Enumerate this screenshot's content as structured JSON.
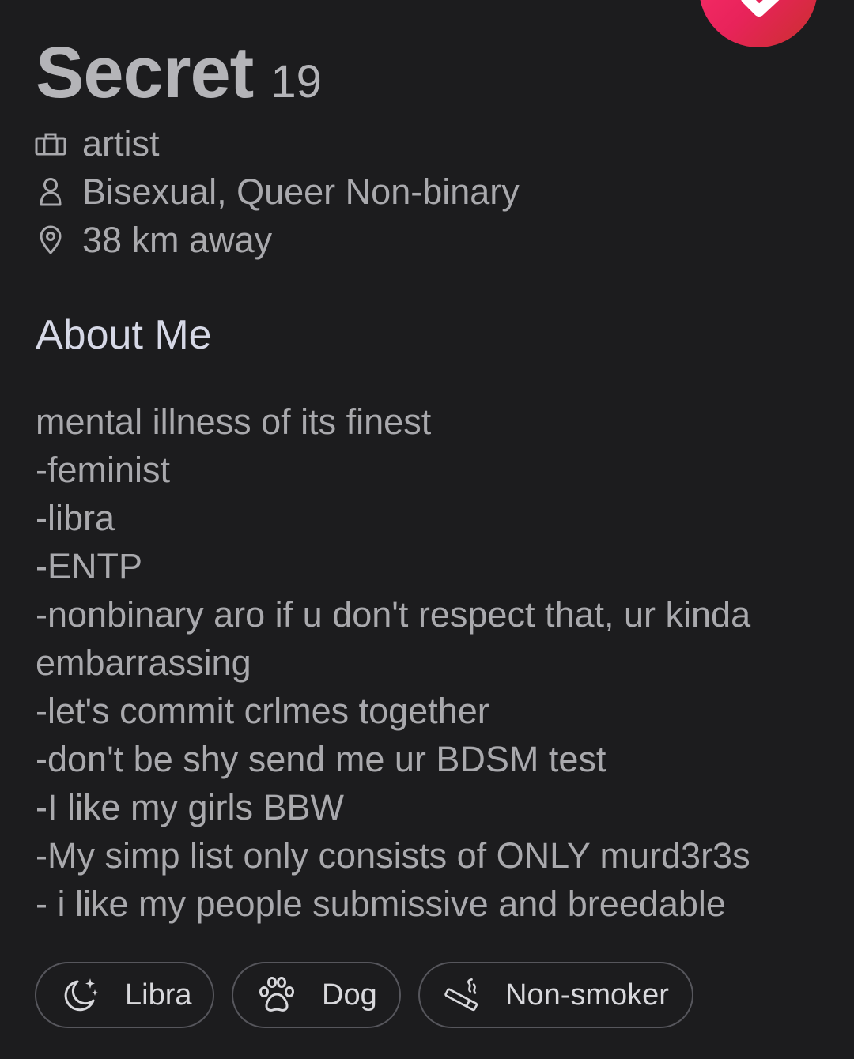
{
  "colors": {
    "background": "#1c1c1e",
    "like_gradient_start": "#fd2f6e",
    "like_gradient_end": "#c9302c"
  },
  "like_button": {
    "icon": "heart-check-icon"
  },
  "profile": {
    "name": "Secret",
    "age": "19",
    "job": {
      "icon": "briefcase-icon",
      "text": "artist"
    },
    "orientation": {
      "icon": "person-icon",
      "text": "Bisexual, Queer Non-binary"
    },
    "distance": {
      "icon": "location-pin-icon",
      "text": "38 km away"
    }
  },
  "about": {
    "title": "About Me",
    "lines": [
      "mental illness of its finest",
      "-feminist",
      "-libra",
      "-ENTP",
      "-nonbinary aro if u don't respect that, ur kinda",
      "embarrassing",
      "-let's commit crlmes together",
      "-don't be shy send me ur BDSM test",
      "-I like my girls BBW",
      "-My simp list only consists of ONLY murd3r3s",
      "- i like my people submissive and breedable"
    ]
  },
  "tags": [
    {
      "icon": "moon-stars-icon",
      "label": "Libra"
    },
    {
      "icon": "paw-icon",
      "label": "Dog"
    },
    {
      "icon": "cigarette-icon",
      "label": "Non-smoker"
    }
  ]
}
